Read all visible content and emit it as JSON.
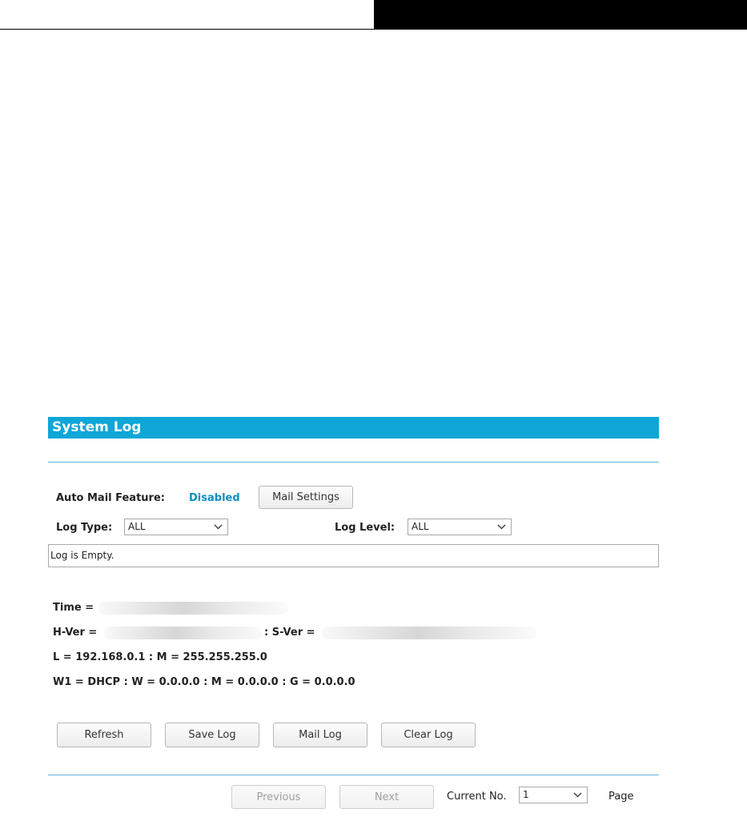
{
  "panel": {
    "title": "System Log"
  },
  "mail": {
    "label": "Auto Mail Feature:",
    "status": "Disabled",
    "settings_button": "Mail Settings"
  },
  "filters": {
    "log_type_label": "Log Type:",
    "log_type_value": "ALL",
    "log_level_label": "Log Level:",
    "log_level_value": "ALL"
  },
  "log": {
    "content": "Log is Empty."
  },
  "info": {
    "time_label": "Time =",
    "hver_label": "H-Ver =",
    "sver_label": ": S-Ver =",
    "lan_line": "L = 192.168.0.1 : M = 255.255.255.0",
    "wan_line": "W1 = DHCP : W = 0.0.0.0 : M = 0.0.0.0 : G = 0.0.0.0"
  },
  "actions": {
    "refresh": "Refresh",
    "save_log": "Save Log",
    "mail_log": "Mail Log",
    "clear_log": "Clear Log"
  },
  "pager": {
    "previous": "Previous",
    "next": "Next",
    "current_label": "Current No.",
    "current_value": "1",
    "page_label": "Page"
  },
  "colors": {
    "accent": "#0fa6d8",
    "status_blue": "#0a8fc6"
  }
}
